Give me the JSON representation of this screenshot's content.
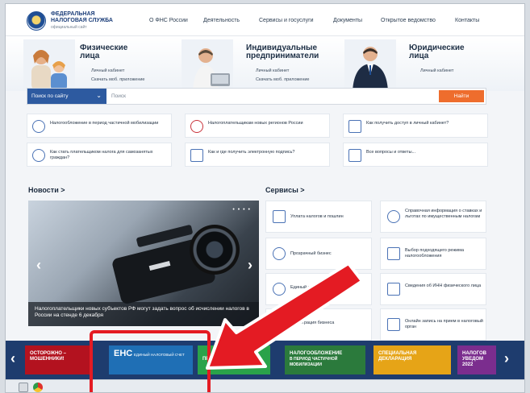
{
  "header": {
    "logo_line1": "ФЕДЕРАЛЬНАЯ",
    "logo_line2": "НАЛОГОВАЯ СЛУЖБА",
    "logo_sub": "официальный сайт",
    "nav": [
      "О ФНС России",
      "Деятельность",
      "Сервисы и госуслуги",
      "Документы",
      "Открытое ведомство",
      "Контакты"
    ]
  },
  "personas": [
    {
      "title_1": "Физические",
      "title_2": "лица",
      "link1": "Личный кабинет",
      "link2": "Скачать моб. приложение"
    },
    {
      "title_1": "Индивидуальные",
      "title_2": "предприниматели",
      "link1": "Личный кабинет",
      "link2": "Скачать моб. приложение"
    },
    {
      "title_1": "Юридические",
      "title_2": "лица",
      "link1": "Личный кабинет",
      "link2": ""
    }
  ],
  "search": {
    "scope": "Поиск по сайту",
    "placeholder": "Поиск",
    "button": "Найти"
  },
  "quick": [
    "Налогообложение в период частичной мобилизации",
    "Налогоплательщикам новых регионов России",
    "Как получить доступ в личный кабинет?",
    "Как стать плательщиком налога для самозанятых граждан?",
    "Как и где получить электронную подпись?",
    "Все вопросы и ответы..."
  ],
  "news": {
    "title": "Новости >",
    "caption": "Налогоплательщики новых субъектов РФ могут задать вопрос об исчислении налогов в России на стенде 6 декабря",
    "dots": "• • • •"
  },
  "services": {
    "title": "Сервисы >",
    "items": [
      "Уплата налогов и пошлин",
      "Справочная информация о ставках и льготах по имущественным налогам",
      "Прозрачный бизнес",
      "Выбор подходящего режима налогообложения",
      "Единый налоговый счет",
      "Сведения об ИНН физического лица",
      "Регистрация бизнеса",
      "Онлайн запись на прием в налоговый орган"
    ]
  },
  "banners": [
    {
      "line1": "ОСТОРОЖНО –",
      "line2": "МОШЕННИКИ!",
      "bg": "#b3121f"
    },
    {
      "line1": "ЕНС",
      "line2": "ЕДИНЫЙ НАЛОГОВЫЙ СЧЕТ",
      "bg": "#1f6fb5"
    },
    {
      "line1": "",
      "line2": "ПРОЕКТЫ",
      "bg": "#2aa24a"
    },
    {
      "line1": "НАЛОГООБЛОЖЕНИЕ",
      "line2": "В ПЕРИОД ЧАСТИЧНОЙ МОБИЛИЗАЦИИ",
      "bg": "#2b7a3c"
    },
    {
      "line1": "СПЕЦИАЛЬНАЯ",
      "line2": "ДЕКЛАРАЦИЯ",
      "bg": "#e6a417"
    },
    {
      "line1": "НАЛОГОВ",
      "line2": "УВЕДОМ",
      "line3": "2022",
      "bg": "#7b2d8e"
    }
  ],
  "colors": {
    "accent": "#2d5aa0",
    "search_button": "#ee6d2d",
    "annotation": "#e41b23"
  }
}
